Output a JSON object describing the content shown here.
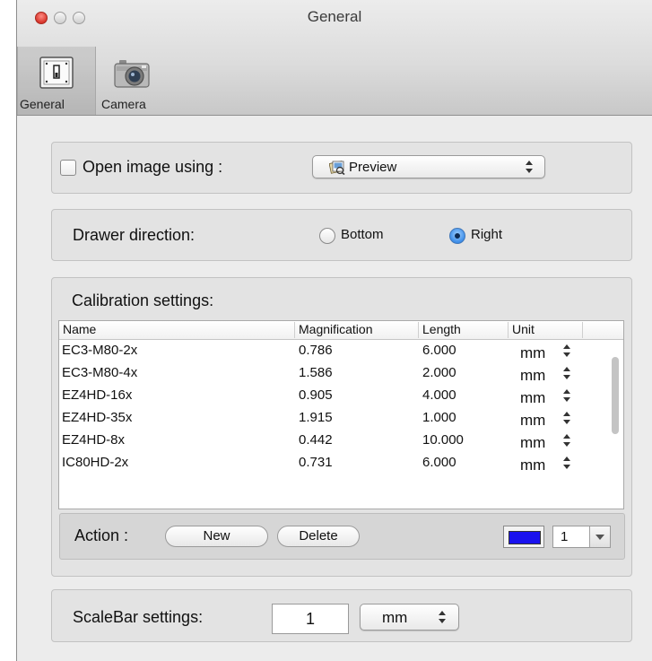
{
  "window": {
    "title": "General"
  },
  "toolbar": {
    "items": [
      {
        "label": "General",
        "icon": "general-prefs-icon",
        "selected": true
      },
      {
        "label": "Camera",
        "icon": "camera-icon",
        "selected": false
      }
    ]
  },
  "open_image": {
    "label": "Open image using :",
    "checked": false,
    "app": "Preview",
    "app_icon": "preview-app-icon"
  },
  "drawer": {
    "label": "Drawer direction:",
    "options": [
      "Bottom",
      "Right"
    ],
    "selected": "Right"
  },
  "calibration": {
    "title": "Calibration settings:",
    "columns": [
      "Name",
      "Magnification",
      "Length",
      "Unit"
    ],
    "rows": [
      {
        "name": "EC3-M80-2x",
        "magnification": "0.786",
        "length": "6.000",
        "unit": "mm"
      },
      {
        "name": "EC3-M80-4x",
        "magnification": "1.586",
        "length": "2.000",
        "unit": "mm"
      },
      {
        "name": "EZ4HD-16x",
        "magnification": "0.905",
        "length": "4.000",
        "unit": "mm"
      },
      {
        "name": "EZ4HD-35x",
        "magnification": "1.915",
        "length": "1.000",
        "unit": "mm"
      },
      {
        "name": "EZ4HD-8x",
        "magnification": "0.442",
        "length": "10.000",
        "unit": "mm"
      },
      {
        "name": "IC80HD-2x",
        "magnification": "0.731",
        "length": "6.000",
        "unit": "mm"
      }
    ],
    "action_label": "Action :",
    "new_label": "New",
    "delete_label": "Delete",
    "color": "#1a12ee",
    "line_width": "1"
  },
  "scalebar": {
    "label": "ScaleBar settings:",
    "value": "1",
    "unit": "mm"
  }
}
